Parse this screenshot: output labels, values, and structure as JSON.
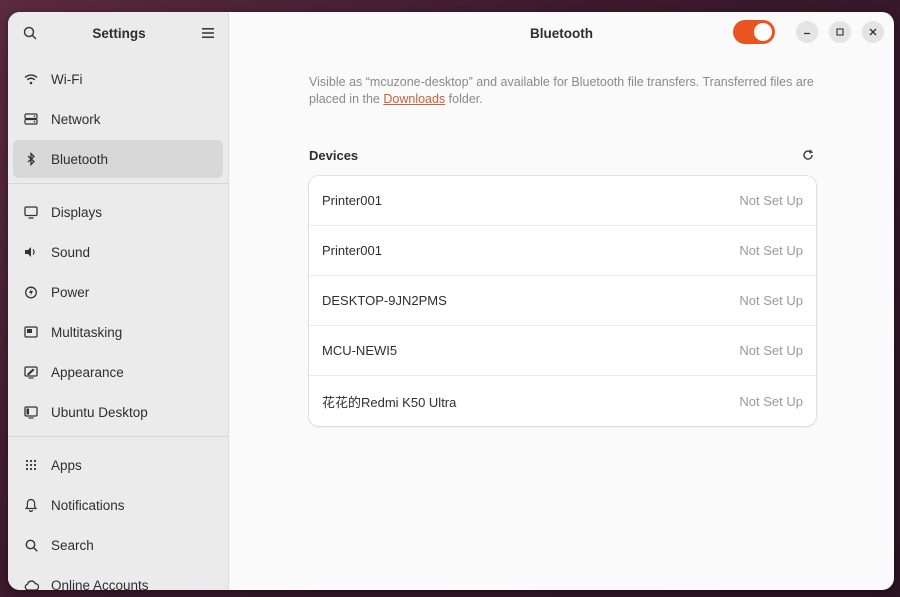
{
  "sidebar": {
    "title": "Settings",
    "groups": [
      [
        {
          "label": "Wi-Fi",
          "icon": "wifi-icon"
        },
        {
          "label": "Network",
          "icon": "network-icon"
        },
        {
          "label": "Bluetooth",
          "icon": "bluetooth-icon",
          "active": true
        }
      ],
      [
        {
          "label": "Displays",
          "icon": "display-icon"
        },
        {
          "label": "Sound",
          "icon": "speaker-icon"
        },
        {
          "label": "Power",
          "icon": "power-icon"
        },
        {
          "label": "Multitasking",
          "icon": "multitasking-icon"
        },
        {
          "label": "Appearance",
          "icon": "appearance-icon"
        },
        {
          "label": "Ubuntu Desktop",
          "icon": "ubuntu-desktop-icon"
        }
      ],
      [
        {
          "label": "Apps",
          "icon": "apps-grid-icon"
        },
        {
          "label": "Notifications",
          "icon": "bell-icon"
        },
        {
          "label": "Search",
          "icon": "search-icon"
        },
        {
          "label": "Online Accounts",
          "icon": "cloud-icon"
        }
      ]
    ]
  },
  "header": {
    "title": "Bluetooth",
    "bluetooth_enabled": true,
    "accent_color": "#e95420"
  },
  "description": {
    "before_link": "Visible as “mcuzone-desktop” and available for Bluetooth file transfers. Transferred files are placed in the ",
    "link": "Downloads",
    "after_link": " folder."
  },
  "devices": {
    "title": "Devices",
    "items": [
      {
        "name": "Printer001",
        "status": "Not Set Up"
      },
      {
        "name": "Printer001",
        "status": "Not Set Up"
      },
      {
        "name": "DESKTOP-9JN2PMS",
        "status": "Not Set Up"
      },
      {
        "name": "MCU-NEWI5",
        "status": "Not Set Up"
      },
      {
        "name": "花花的Redmi K50 Ultra",
        "status": "Not Set Up"
      }
    ]
  }
}
